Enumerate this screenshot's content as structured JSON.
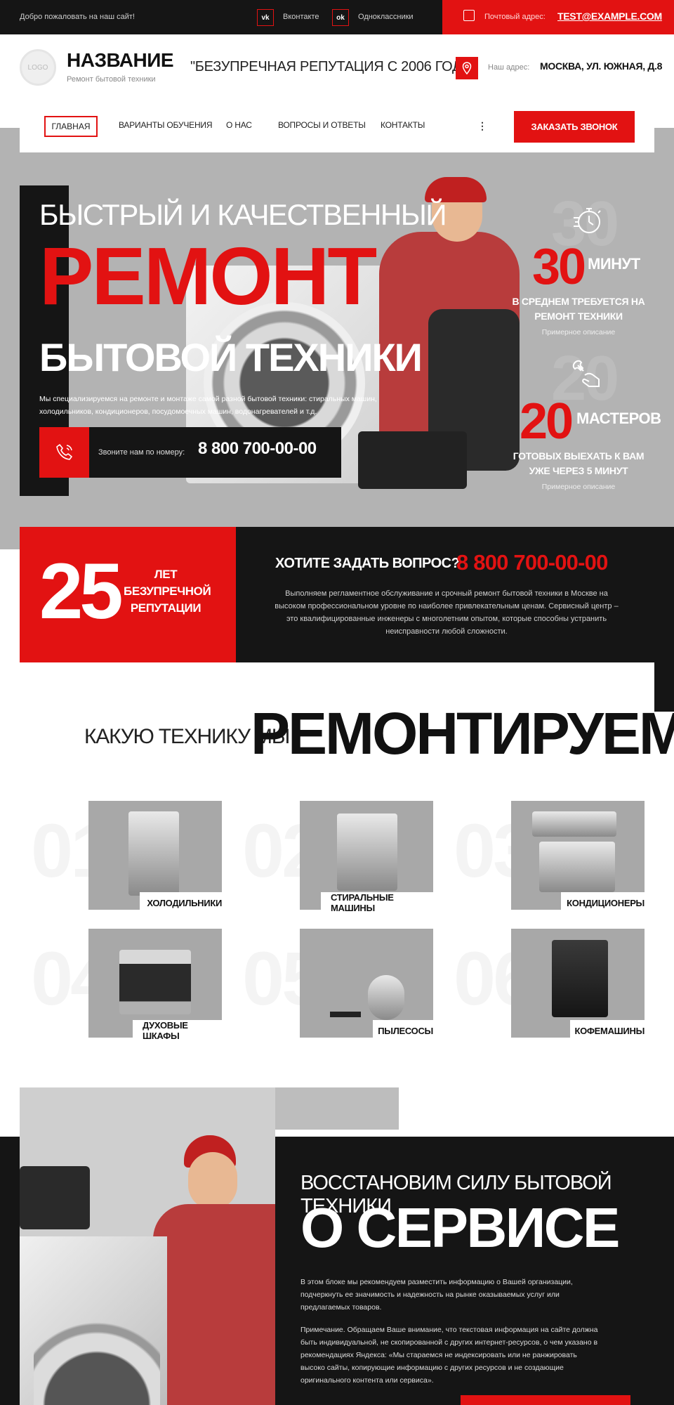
{
  "topbar": {
    "welcome": "Добро пожаловать на наш сайт!",
    "social": [
      {
        "icon": "vk-icon",
        "glyph": "vk",
        "label": "Вконтакте"
      },
      {
        "icon": "odnoklassniki-icon",
        "glyph": "ok",
        "label": "Одноклассники"
      }
    ],
    "mail_label": "Почтовый адрес:",
    "mail_value": "TEST@EXAMPLE.COM"
  },
  "header": {
    "logo": "LOGO",
    "brand": "НАЗВАНИЕ",
    "brand_sub": "Ремонт бытовой техники",
    "slogan": "\"БЕЗУПРЕЧНАЯ РЕПУТАЦИЯ С 2006 ГОДА\"",
    "address_label": "Наш адрес:",
    "address_value": "МОСКВА, УЛ. ЮЖНАЯ, Д.8"
  },
  "nav": {
    "items": [
      "ГЛАВНАЯ",
      "ВАРИАНТЫ ОБУЧЕНИЯ",
      "О НАС",
      "ВОПРОСЫ И ОТВЕТЫ",
      "КОНТАКТЫ"
    ],
    "more": "⋮",
    "cta": "ЗАКАЗАТЬ ЗВОНОК"
  },
  "hero": {
    "line1": "БЫСТРЫЙ И КАЧЕСТВЕННЫЙ",
    "line2": "РЕМОНТ",
    "line3": "БЫТОВОЙ ТЕХНИКИ",
    "desc": "Мы специализируемся на ремонте и монтаже самой разной бытовой техники: стиральных машин, холодильников, кондиционеров, посудомоечных машин, водонагревателей и т.д.",
    "phone_label": "Звоните нам по номеру:",
    "phone_value": "8 800 700-00-00"
  },
  "stats": [
    {
      "icon": "stopwatch-icon",
      "number": "30",
      "unit": "МИНУТ",
      "desc": "В СРЕДНЕМ ТРЕБУЕТСЯ НА РЕМОНТ ТЕХНИКИ",
      "note": "Примерное описание"
    },
    {
      "icon": "wrench-hand-icon",
      "number": "20",
      "unit": "МАСТЕРОВ",
      "desc": "ГОТОВЫХ ВЫЕХАТЬ К ВАМ УЖЕ ЧЕРЕЗ 5 МИНУТ",
      "note": "Примерное описание"
    }
  ],
  "reputation": {
    "number": "25",
    "text": "ЛЕТ БЕЗУПРЕЧНОЙ РЕПУТАЦИИ",
    "question": "ХОТИТЕ ЗАДАТЬ ВОПРОС?",
    "phone": "8 800 700-00-00",
    "desc": "Выполняем регламентное обслуживание и срочный ремонт бытовой техники в Москве на высоком профессиональном уровне по наиболее привлекательным ценам. Сервисный центр – это квалифицированные инженеры с многолетним опытом, которые способны устранить неисправности любой сложности."
  },
  "repairs": {
    "subtitle": "КАКУЮ ТЕХНИКУ МЫ",
    "title": "РЕМОНТИРУЕМ",
    "items": [
      {
        "num": "01",
        "label": "ХОЛОДИЛЬНИКИ",
        "icon": "fridge-icon"
      },
      {
        "num": "02",
        "label": "СТИРАЛЬНЫЕ МАШИНЫ",
        "icon": "washing-machine-icon"
      },
      {
        "num": "03",
        "label": "КОНДИЦИОНЕРЫ",
        "icon": "air-conditioner-icon"
      },
      {
        "num": "04",
        "label": "ДУХОВЫЕ ШКАФЫ",
        "icon": "oven-icon"
      },
      {
        "num": "05",
        "label": "ПЫЛЕСОСЫ",
        "icon": "vacuum-cleaner-icon"
      },
      {
        "num": "06",
        "label": "КОФЕМАШИНЫ",
        "icon": "coffee-machine-icon"
      }
    ]
  },
  "service": {
    "subtitle": "ВОССТАНОВИМ СИЛУ БЫТОВОЙ ТЕХНИКИ",
    "title": "О СЕРВИСЕ",
    "p1": "В этом блоке мы рекомендуем разместить информацию о Вашей организации, подчеркнуть ее значимость и надежность на рынке оказываемых услуг или предлагаемых товаров.",
    "p2": "Примечание. Обращаем Ваше внимание, что текстовая информация на сайте должна быть индивидуальной, не скопированной с других интернет-ресурсов, о чем указано в рекомендациях Яндекса: «Мы стараемся не индексировать или не ранжировать высоко сайты, копирующие информацию с других ресурсов и не создающие оригинального контента или сервиса»."
  },
  "colors": {
    "accent": "#e21212",
    "dark": "#151515",
    "gray": "#b3b3b3"
  }
}
